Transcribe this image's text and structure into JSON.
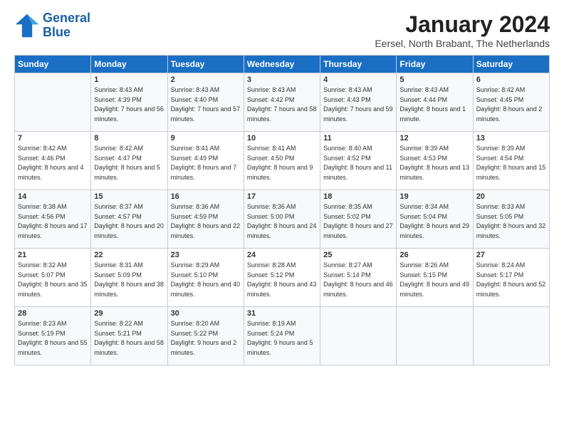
{
  "logo": {
    "line1": "General",
    "line2": "Blue"
  },
  "title": "January 2024",
  "location": "Eersel, North Brabant, The Netherlands",
  "days_of_week": [
    "Sunday",
    "Monday",
    "Tuesday",
    "Wednesday",
    "Thursday",
    "Friday",
    "Saturday"
  ],
  "weeks": [
    [
      {
        "day": "",
        "sunrise": "",
        "sunset": "",
        "daylight": ""
      },
      {
        "day": "1",
        "sunrise": "Sunrise: 8:43 AM",
        "sunset": "Sunset: 4:39 PM",
        "daylight": "Daylight: 7 hours and 56 minutes."
      },
      {
        "day": "2",
        "sunrise": "Sunrise: 8:43 AM",
        "sunset": "Sunset: 4:40 PM",
        "daylight": "Daylight: 7 hours and 57 minutes."
      },
      {
        "day": "3",
        "sunrise": "Sunrise: 8:43 AM",
        "sunset": "Sunset: 4:42 PM",
        "daylight": "Daylight: 7 hours and 58 minutes."
      },
      {
        "day": "4",
        "sunrise": "Sunrise: 8:43 AM",
        "sunset": "Sunset: 4:43 PM",
        "daylight": "Daylight: 7 hours and 59 minutes."
      },
      {
        "day": "5",
        "sunrise": "Sunrise: 8:43 AM",
        "sunset": "Sunset: 4:44 PM",
        "daylight": "Daylight: 8 hours and 1 minute."
      },
      {
        "day": "6",
        "sunrise": "Sunrise: 8:42 AM",
        "sunset": "Sunset: 4:45 PM",
        "daylight": "Daylight: 8 hours and 2 minutes."
      }
    ],
    [
      {
        "day": "7",
        "sunrise": "Sunrise: 8:42 AM",
        "sunset": "Sunset: 4:46 PM",
        "daylight": "Daylight: 8 hours and 4 minutes."
      },
      {
        "day": "8",
        "sunrise": "Sunrise: 8:42 AM",
        "sunset": "Sunset: 4:47 PM",
        "daylight": "Daylight: 8 hours and 5 minutes."
      },
      {
        "day": "9",
        "sunrise": "Sunrise: 8:41 AM",
        "sunset": "Sunset: 4:49 PM",
        "daylight": "Daylight: 8 hours and 7 minutes."
      },
      {
        "day": "10",
        "sunrise": "Sunrise: 8:41 AM",
        "sunset": "Sunset: 4:50 PM",
        "daylight": "Daylight: 8 hours and 9 minutes."
      },
      {
        "day": "11",
        "sunrise": "Sunrise: 8:40 AM",
        "sunset": "Sunset: 4:52 PM",
        "daylight": "Daylight: 8 hours and 11 minutes."
      },
      {
        "day": "12",
        "sunrise": "Sunrise: 8:39 AM",
        "sunset": "Sunset: 4:53 PM",
        "daylight": "Daylight: 8 hours and 13 minutes."
      },
      {
        "day": "13",
        "sunrise": "Sunrise: 8:39 AM",
        "sunset": "Sunset: 4:54 PM",
        "daylight": "Daylight: 8 hours and 15 minutes."
      }
    ],
    [
      {
        "day": "14",
        "sunrise": "Sunrise: 8:38 AM",
        "sunset": "Sunset: 4:56 PM",
        "daylight": "Daylight: 8 hours and 17 minutes."
      },
      {
        "day": "15",
        "sunrise": "Sunrise: 8:37 AM",
        "sunset": "Sunset: 4:57 PM",
        "daylight": "Daylight: 8 hours and 20 minutes."
      },
      {
        "day": "16",
        "sunrise": "Sunrise: 8:36 AM",
        "sunset": "Sunset: 4:59 PM",
        "daylight": "Daylight: 8 hours and 22 minutes."
      },
      {
        "day": "17",
        "sunrise": "Sunrise: 8:36 AM",
        "sunset": "Sunset: 5:00 PM",
        "daylight": "Daylight: 8 hours and 24 minutes."
      },
      {
        "day": "18",
        "sunrise": "Sunrise: 8:35 AM",
        "sunset": "Sunset: 5:02 PM",
        "daylight": "Daylight: 8 hours and 27 minutes."
      },
      {
        "day": "19",
        "sunrise": "Sunrise: 8:34 AM",
        "sunset": "Sunset: 5:04 PM",
        "daylight": "Daylight: 8 hours and 29 minutes."
      },
      {
        "day": "20",
        "sunrise": "Sunrise: 8:33 AM",
        "sunset": "Sunset: 5:05 PM",
        "daylight": "Daylight: 8 hours and 32 minutes."
      }
    ],
    [
      {
        "day": "21",
        "sunrise": "Sunrise: 8:32 AM",
        "sunset": "Sunset: 5:07 PM",
        "daylight": "Daylight: 8 hours and 35 minutes."
      },
      {
        "day": "22",
        "sunrise": "Sunrise: 8:31 AM",
        "sunset": "Sunset: 5:09 PM",
        "daylight": "Daylight: 8 hours and 38 minutes."
      },
      {
        "day": "23",
        "sunrise": "Sunrise: 8:29 AM",
        "sunset": "Sunset: 5:10 PM",
        "daylight": "Daylight: 8 hours and 40 minutes."
      },
      {
        "day": "24",
        "sunrise": "Sunrise: 8:28 AM",
        "sunset": "Sunset: 5:12 PM",
        "daylight": "Daylight: 8 hours and 43 minutes."
      },
      {
        "day": "25",
        "sunrise": "Sunrise: 8:27 AM",
        "sunset": "Sunset: 5:14 PM",
        "daylight": "Daylight: 8 hours and 46 minutes."
      },
      {
        "day": "26",
        "sunrise": "Sunrise: 8:26 AM",
        "sunset": "Sunset: 5:15 PM",
        "daylight": "Daylight: 8 hours and 49 minutes."
      },
      {
        "day": "27",
        "sunrise": "Sunrise: 8:24 AM",
        "sunset": "Sunset: 5:17 PM",
        "daylight": "Daylight: 8 hours and 52 minutes."
      }
    ],
    [
      {
        "day": "28",
        "sunrise": "Sunrise: 8:23 AM",
        "sunset": "Sunset: 5:19 PM",
        "daylight": "Daylight: 8 hours and 55 minutes."
      },
      {
        "day": "29",
        "sunrise": "Sunrise: 8:22 AM",
        "sunset": "Sunset: 5:21 PM",
        "daylight": "Daylight: 8 hours and 58 minutes."
      },
      {
        "day": "30",
        "sunrise": "Sunrise: 8:20 AM",
        "sunset": "Sunset: 5:22 PM",
        "daylight": "Daylight: 9 hours and 2 minutes."
      },
      {
        "day": "31",
        "sunrise": "Sunrise: 8:19 AM",
        "sunset": "Sunset: 5:24 PM",
        "daylight": "Daylight: 9 hours and 5 minutes."
      },
      {
        "day": "",
        "sunrise": "",
        "sunset": "",
        "daylight": ""
      },
      {
        "day": "",
        "sunrise": "",
        "sunset": "",
        "daylight": ""
      },
      {
        "day": "",
        "sunrise": "",
        "sunset": "",
        "daylight": ""
      }
    ]
  ]
}
